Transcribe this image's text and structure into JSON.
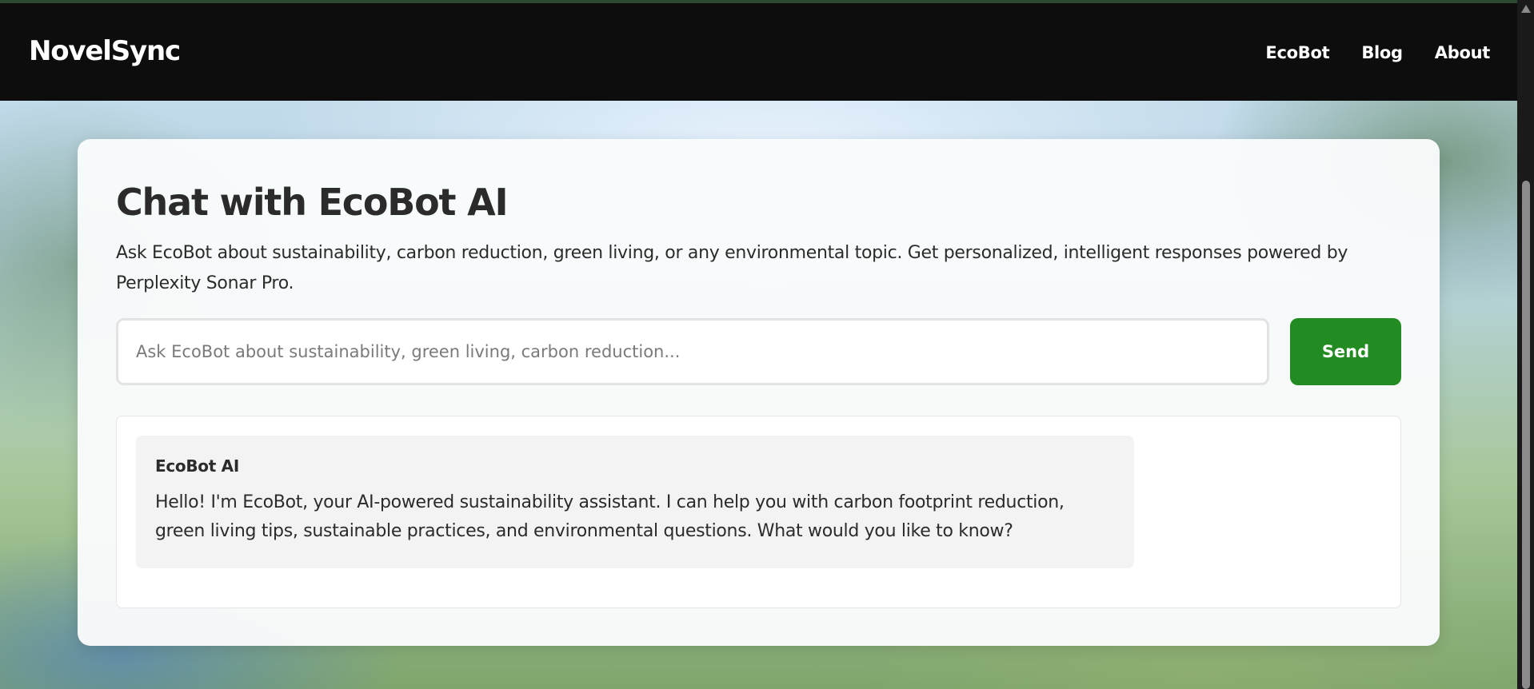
{
  "navbar": {
    "brand": "NovelSync",
    "links": [
      {
        "label": "EcoBot"
      },
      {
        "label": "Blog"
      },
      {
        "label": "About"
      }
    ]
  },
  "chat": {
    "title": "Chat with EcoBot AI",
    "description": "Ask EcoBot about sustainability, carbon reduction, green living, or any environmental topic. Get personalized, intelligent responses powered by Perplexity Sonar Pro.",
    "input": {
      "value": "",
      "placeholder": "Ask EcoBot about sustainability, green living, carbon reduction..."
    },
    "send_label": "Send",
    "messages": [
      {
        "sender": "EcoBot AI",
        "text": "Hello! I'm EcoBot, your AI-powered sustainability assistant. I can help you with carbon footprint reduction, green living tips, sustainable practices, and environmental questions. What would you like to know?"
      }
    ]
  },
  "colors": {
    "navbar_bg": "#0d0d0d",
    "accent": "#228b22",
    "card_bg": "#fafcfc",
    "message_bg": "#f3f3f3"
  }
}
